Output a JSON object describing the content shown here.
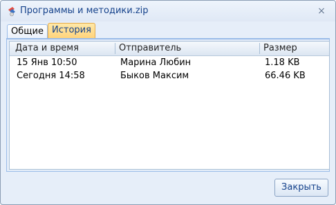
{
  "window": {
    "title": "Программы и методики.zip",
    "close_symbol": "×"
  },
  "tabs": [
    {
      "label": "Общие",
      "active": false
    },
    {
      "label": "История",
      "active": true
    }
  ],
  "table": {
    "columns": [
      "Дата и время",
      "Отправитель",
      "Размер"
    ],
    "rows": [
      [
        "15 Янв 10:50",
        "Марина Любин",
        "1.18 KB"
      ],
      [
        "Сегодня 14:58",
        "Быков Максим",
        "66.46 KB"
      ]
    ]
  },
  "footer": {
    "close_label": "Закрыть"
  },
  "colors": {
    "title": "#15428b",
    "active_tab": "#ffd37a",
    "border": "#99bbe8"
  }
}
